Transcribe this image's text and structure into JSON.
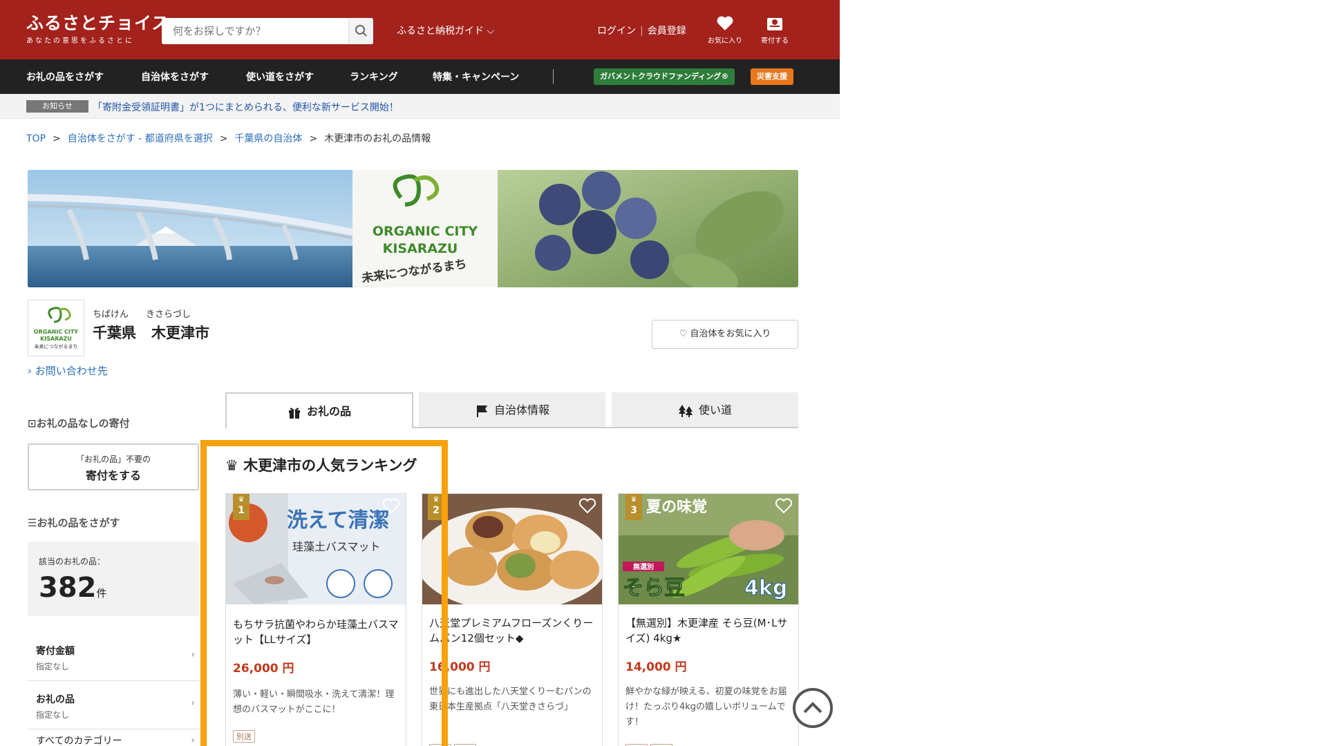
{
  "header": {
    "logo_main": "ふるさとチョイス",
    "logo_sub": "あなたの意思をふるさとに",
    "search_placeholder": "何をお探しですか？",
    "guide_label": "ふるさと納税ガイド",
    "login": "ログイン",
    "register": "会員登録",
    "favorites": "お気に入り",
    "donate": "寄付する"
  },
  "nav": {
    "items": [
      "お礼の品をさがす",
      "自治体をさがす",
      "使い道をさがす",
      "ランキング",
      "特集・キャンペーン"
    ],
    "gcf": "ガバメントクラウドファンディング®",
    "disaster": "災害支援"
  },
  "notice": {
    "label": "お知らせ",
    "text": "「寄附金受領証明書」が1つにまとめられる、便利な新サービス開始！"
  },
  "breadcrumb": [
    "TOP",
    "自治体をさがす - 都道府県を選択",
    "千葉県の自治体",
    "木更津市のお礼の品情報"
  ],
  "banner": {
    "brand_line1": "ORGANIC CITY",
    "brand_line2": "KISARAZU",
    "tagline": "未来につながるまち"
  },
  "municipality": {
    "pref_ruby": "ちばけん",
    "city_ruby": "きさらづし",
    "pref": "千葉県",
    "city": "木更津市",
    "favorite_button": "自治体をお気に入り",
    "inquiry": "› お問い合わせ先"
  },
  "sidebar": {
    "no_gift_heading": "お礼の品なしの寄付",
    "donate_small": "「お礼の品」不要の",
    "donate_big": "寄付をする",
    "search_heading": "お礼の品をさがす",
    "count_label": "該当のお礼の品：",
    "count": "382",
    "count_unit": "件",
    "filters": [
      {
        "title": "寄付金額",
        "sub": "指定なし"
      },
      {
        "title": "お礼の品",
        "sub": "指定なし"
      },
      {
        "title": "すべてのカテゴリー",
        "sub": ""
      }
    ]
  },
  "tabs": [
    "お礼の品",
    "自治体情報",
    "使い道"
  ],
  "ranking": {
    "title": "木更津市の人気ランキング",
    "items": [
      {
        "rank": "1",
        "image_text": "洗えて清潔",
        "image_sub": "珪藻土バスマット",
        "title": "もちサラ抗菌やわらか珪藻土バスマット【LLサイズ】",
        "price": "26,000 円",
        "desc": "薄い・軽い・瞬間吸水・洗えて清潔！理想のバスマットがここに！",
        "tags": [
          "別送"
        ]
      },
      {
        "rank": "2",
        "title": "八天堂プレミアムフローズンくりームパン12個セット◆",
        "price": "16,000 円",
        "desc": "世界にも進出した八天堂くりーむパンの東日本生産拠点「八天堂きさらづ」",
        "tags": [
          "常温",
          "別送"
        ]
      },
      {
        "rank": "3",
        "image_text": "夏の味覚",
        "image_sub": "そら豆",
        "image_weight": "4kg",
        "image_badge": "無選別",
        "title": "【無選別】木更津産 そら豆(M･Lサイズ) 4kg★",
        "price": "14,000 円",
        "desc": "鮮やかな緑が映える、初夏の味覚をお届け！たっぷり4kgの嬉しいボリュームです！",
        "tags": [
          "常温",
          "別送"
        ]
      }
    ]
  },
  "colors": {
    "header_red": "#a3221c",
    "nav_dark": "#222222",
    "gcf_green": "#2f7d3a",
    "disaster_orange": "#e8771e",
    "highlight_orange": "#f7a10c",
    "price_red": "#c0391b"
  }
}
